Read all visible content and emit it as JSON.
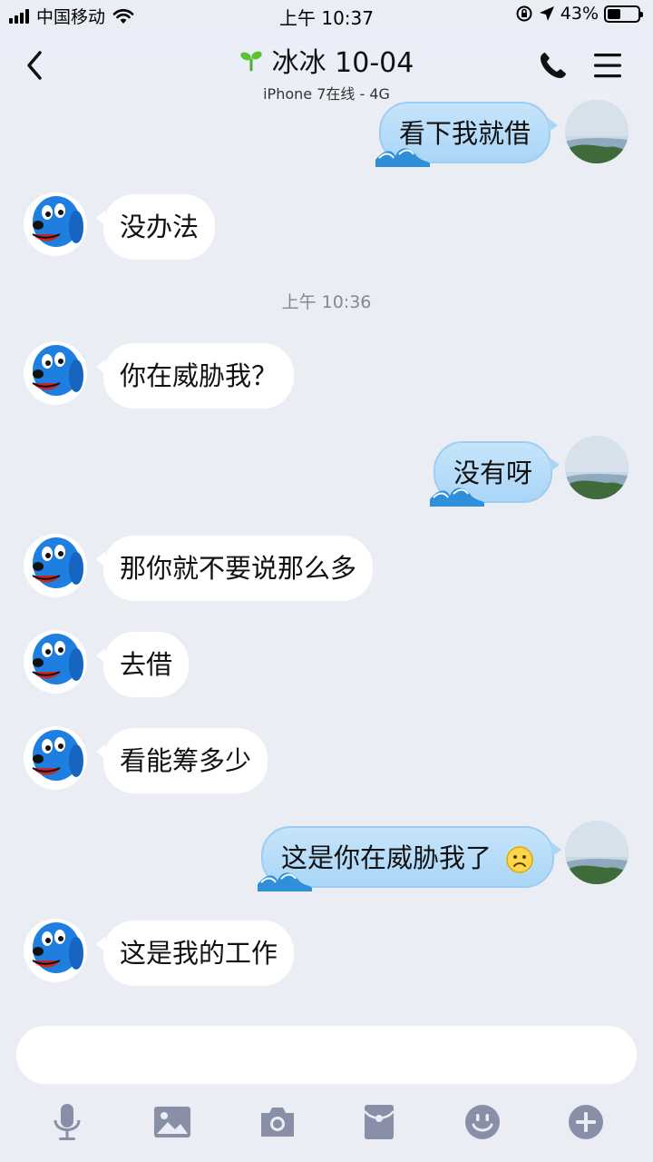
{
  "status_bar": {
    "carrier": "中国移动",
    "time": "上午 10:37",
    "battery": "43%",
    "battery_level": 0.43
  },
  "header": {
    "title": "冰冰 10-04",
    "subtitle": "iPhone 7在线 - 4G"
  },
  "messages": [
    {
      "side": "out",
      "text": "看下我就借"
    },
    {
      "side": "in",
      "text": "没办法"
    },
    {
      "side": "time",
      "text": "上午 10:36"
    },
    {
      "side": "in",
      "text": "你在威胁我？"
    },
    {
      "side": "out",
      "text": "没有呀"
    },
    {
      "side": "in",
      "text": "那你就不要说那么多"
    },
    {
      "side": "in",
      "text": "去借"
    },
    {
      "side": "in",
      "text": "看能筹多少"
    },
    {
      "side": "out",
      "text": "这是你在威胁我了",
      "emoji": "frown-emoji"
    },
    {
      "side": "in",
      "text": "这是我的工作"
    }
  ],
  "input": {
    "value": "",
    "placeholder": ""
  },
  "toolbar_icons": [
    "microphone-icon",
    "image-icon",
    "camera-icon",
    "red-packet-icon",
    "emoji-icon",
    "plus-icon"
  ],
  "colors": {
    "bubble_out": "#b7dcf8",
    "bubble_in": "#ffffff",
    "background": "#eaedf4",
    "toolbar_icon": "#8a8fa8"
  }
}
